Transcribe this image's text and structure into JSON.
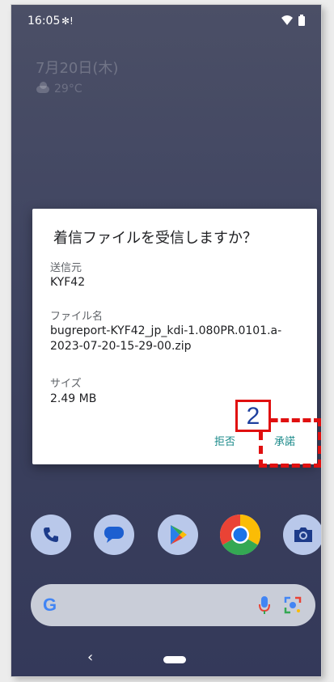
{
  "status_bar": {
    "time": "16:05",
    "notification_glyph": "✻!"
  },
  "lockscreen": {
    "date": "7月20日(木)",
    "weather_temp": "29°C"
  },
  "dialog": {
    "title": "着信ファイルを受信しますか？",
    "sender_label": "送信元",
    "sender_value": "KYF42",
    "filename_label": "ファイル名",
    "filename_value": "bugreport-KYF42_jp_kdi-1.080PR.0101.a-2023-07-20-15-29-00.zip",
    "size_label": "サイズ",
    "size_value": "2.49 MB",
    "decline_label": "拒否",
    "accept_label": "承諾"
  },
  "annotation": {
    "step_number": "2",
    "color": "#e01010"
  },
  "dock": {
    "apps": [
      "phone-icon",
      "messages-icon",
      "play-store-icon",
      "chrome-icon",
      "camera-icon"
    ]
  },
  "search": {
    "logo": "G"
  },
  "nav": {
    "back_glyph": "‹"
  },
  "colors": {
    "accent": "#1a8a8a",
    "wallpaper": "#3f445f"
  }
}
